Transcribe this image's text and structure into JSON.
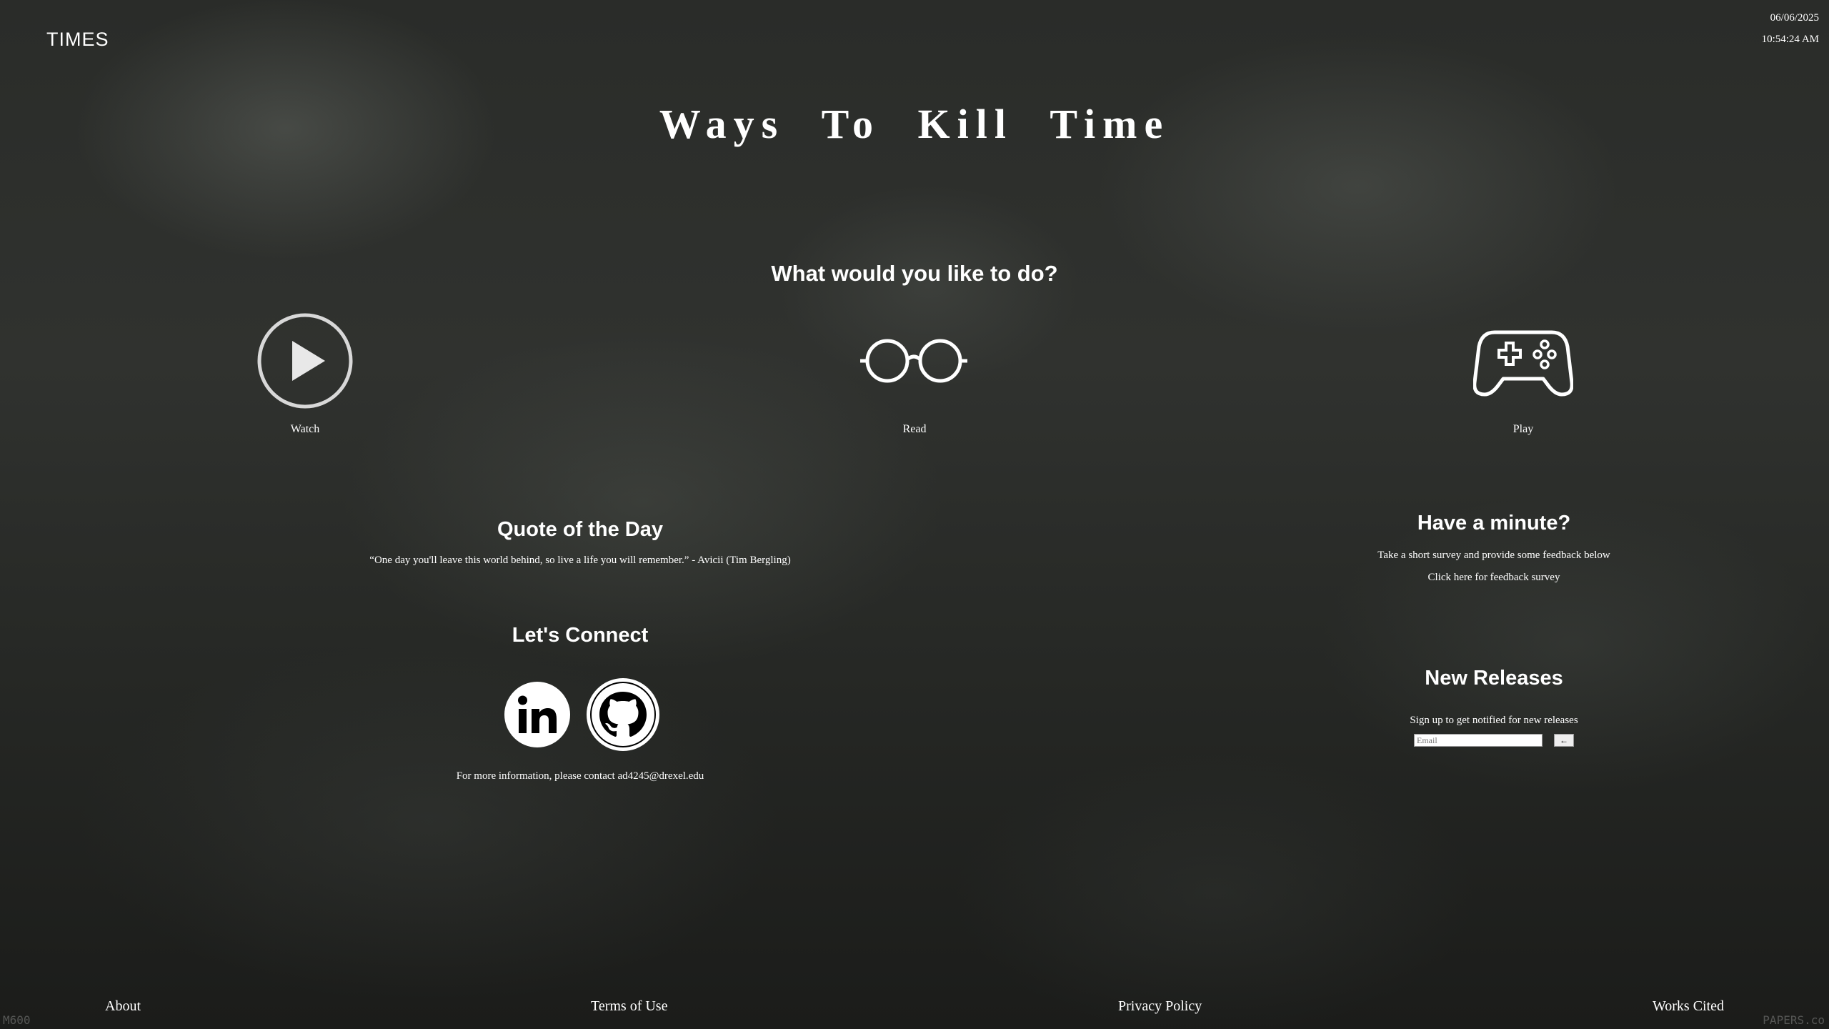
{
  "brand": "TIMES",
  "date": "06/06/2025",
  "time": "10:54:24 AM",
  "title": "Ways To Kill Time",
  "prompt": "What would you like to do?",
  "options": [
    {
      "label": "Watch",
      "icon": "play-icon"
    },
    {
      "label": "Read",
      "icon": "glasses-icon"
    },
    {
      "label": "Play",
      "icon": "gamepad-icon"
    }
  ],
  "quote": {
    "heading": "Quote of the Day",
    "text": "“One day you'll leave this world behind, so live a life you will remember.” - Avicii (Tim Bergling)"
  },
  "connect": {
    "heading": "Let's Connect",
    "contact": "For more information, please contact ad4245@drexel.edu",
    "icons": [
      "linkedin-icon",
      "github-icon"
    ]
  },
  "survey": {
    "heading": "Have a minute?",
    "text": "Take a short survey and provide some feedback below",
    "link": "Click here for feedback survey"
  },
  "releases": {
    "heading": "New Releases",
    "text": "Sign up to get notified for new releases",
    "placeholder": "Email",
    "submit": "←"
  },
  "footer": [
    "About",
    "Terms of Use",
    "Privacy Policy",
    "Works Cited"
  ],
  "watermark_left": "M600",
  "watermark_right": "PAPERS.co"
}
